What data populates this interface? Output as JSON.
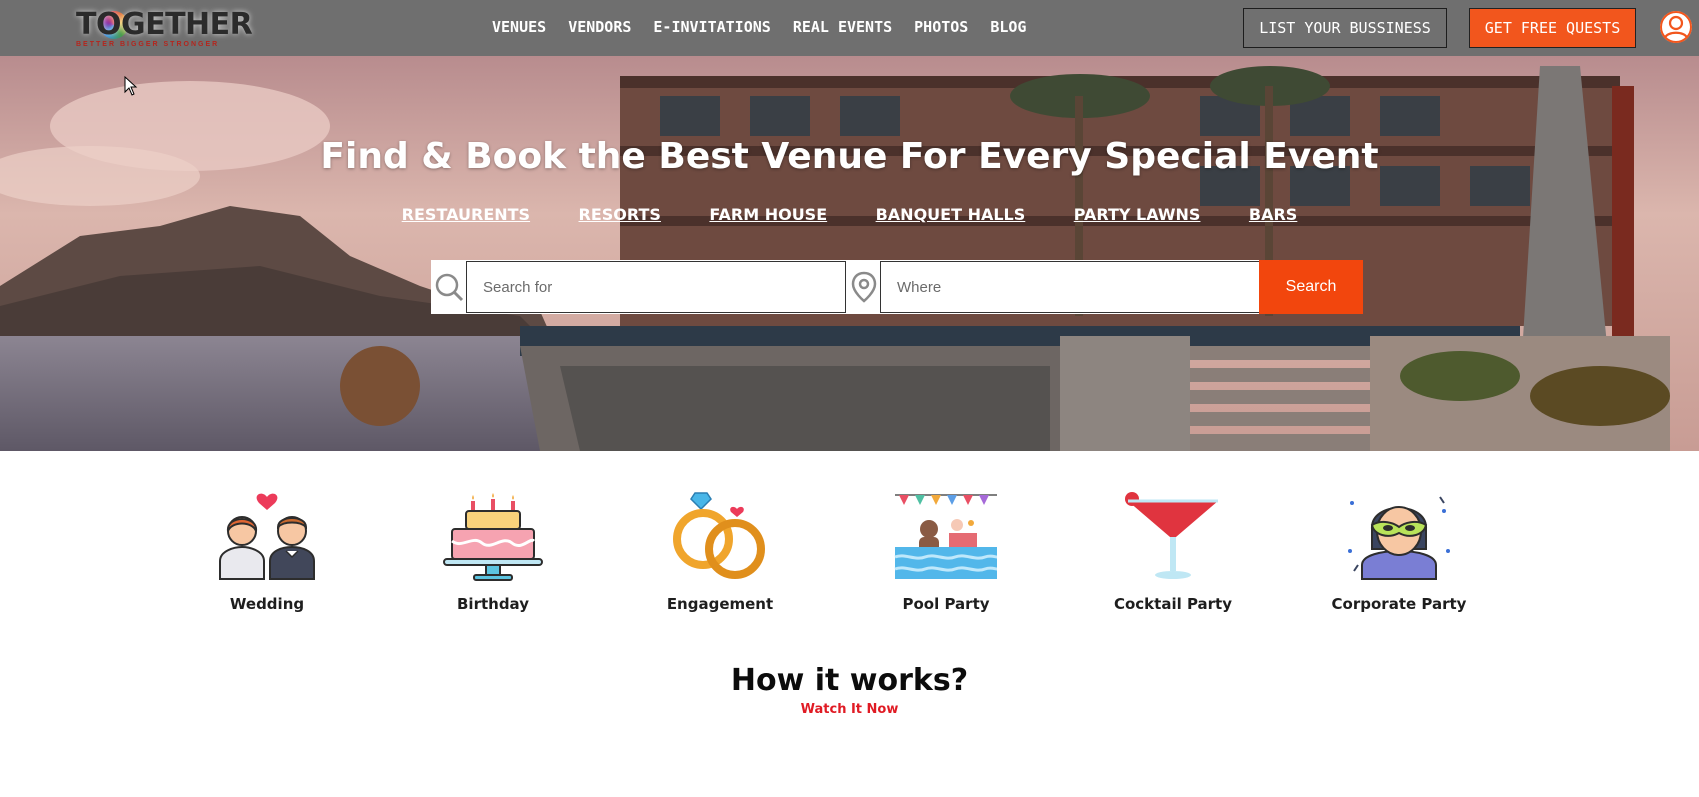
{
  "brand": {
    "logo_text": "TOGETHER",
    "tagline": "BETTER BIGGER STRONGER",
    "accent_color": "#f2561d"
  },
  "nav": {
    "items": [
      "VENUES",
      "VENDORS",
      "E-INVITATIONS",
      "REAL EVENTS",
      "PHOTOS",
      "BLOG"
    ],
    "list_business": "LIST YOUR BUSSINESS",
    "get_quests": "GET FREE QUESTS",
    "user_icon": "user-avatar-icon"
  },
  "hero": {
    "title": "Find & Book the Best Venue For Every Special Event",
    "categories": [
      "RESTAURENTS",
      "RESORTS",
      "FARM HOUSE",
      "BANQUET HALLS",
      "PARTY LAWNS",
      "BARS"
    ],
    "search": {
      "search_placeholder": "Search for",
      "where_placeholder": "Where",
      "button": "Search",
      "search_icon": "search-icon",
      "location_icon": "location-pin-icon"
    }
  },
  "events": [
    {
      "label": "Wedding",
      "icon": "wedding-couple-icon"
    },
    {
      "label": "Birthday",
      "icon": "birthday-cake-icon"
    },
    {
      "label": "Engagement",
      "icon": "engagement-rings-icon"
    },
    {
      "label": "Pool Party",
      "icon": "pool-party-icon"
    },
    {
      "label": "Cocktail Party",
      "icon": "cocktail-glass-icon"
    },
    {
      "label": "Corporate Party",
      "icon": "masquerade-mask-icon"
    }
  ],
  "how_it_works": {
    "title": "How it works?",
    "link": "Watch It Now"
  }
}
